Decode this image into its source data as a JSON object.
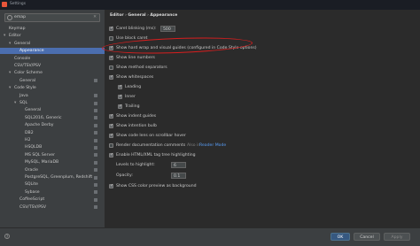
{
  "window": {
    "title": "Settings"
  },
  "search": {
    "value": "emap"
  },
  "tree": [
    {
      "label": "Keymap",
      "depth": 0,
      "arrow": "",
      "selected": false
    },
    {
      "label": "Editor",
      "depth": 0,
      "arrow": "open",
      "selected": false
    },
    {
      "label": "General",
      "depth": 1,
      "arrow": "open",
      "selected": false
    },
    {
      "label": "Appearance",
      "depth": 2,
      "arrow": "",
      "selected": true
    },
    {
      "label": "Console",
      "depth": 1,
      "arrow": "",
      "selected": false
    },
    {
      "label": "CSV/TSV/PSV",
      "depth": 1,
      "arrow": "",
      "selected": false
    },
    {
      "label": "Color Scheme",
      "depth": 1,
      "arrow": "open",
      "selected": false
    },
    {
      "label": "General",
      "depth": 2,
      "arrow": "",
      "selected": false
    },
    {
      "label": "Code Style",
      "depth": 1,
      "arrow": "open",
      "selected": false
    },
    {
      "label": "Java",
      "depth": 2,
      "arrow": "",
      "selected": false
    },
    {
      "label": "SQL",
      "depth": 2,
      "arrow": "open",
      "selected": false
    },
    {
      "label": "General",
      "depth": 3,
      "arrow": "",
      "selected": false
    },
    {
      "label": "SQL2016, Generic",
      "depth": 3,
      "arrow": "",
      "selected": false
    },
    {
      "label": "Apache Derby",
      "depth": 3,
      "arrow": "",
      "selected": false
    },
    {
      "label": "DB2",
      "depth": 3,
      "arrow": "",
      "selected": false
    },
    {
      "label": "H2",
      "depth": 3,
      "arrow": "",
      "selected": false
    },
    {
      "label": "HSQLDB",
      "depth": 3,
      "arrow": "",
      "selected": false
    },
    {
      "label": "MS SQL Server",
      "depth": 3,
      "arrow": "",
      "selected": false
    },
    {
      "label": "MySQL, MariaDB",
      "depth": 3,
      "arrow": "",
      "selected": false
    },
    {
      "label": "Oracle",
      "depth": 3,
      "arrow": "",
      "selected": false
    },
    {
      "label": "PostgreSQL, Greenplum, Redshift",
      "depth": 3,
      "arrow": "",
      "selected": false
    },
    {
      "label": "SQLite",
      "depth": 3,
      "arrow": "",
      "selected": false
    },
    {
      "label": "Sybase",
      "depth": 3,
      "arrow": "",
      "selected": false
    },
    {
      "label": "CoffeeScript",
      "depth": 2,
      "arrow": "",
      "selected": false
    },
    {
      "label": "CSV/TSV/PSV",
      "depth": 2,
      "arrow": "",
      "selected": false
    }
  ],
  "breadcrumb": {
    "part1": "Editor",
    "sep1": "›",
    "part2": "General",
    "sep2": "›",
    "part3": "Appearance"
  },
  "settings": {
    "caret_blinking_label": "Caret blinking (ms):",
    "caret_blinking_value": "500",
    "use_block_caret": "Use block caret",
    "show_hard_wrap": "Show hard wrap and visual guides (configured in Code Style options)",
    "show_line_numbers": "Show line numbers",
    "show_method_separators": "Show method separators",
    "show_whitespaces": "Show whitespaces",
    "leading": "Leading",
    "inner": "Inner",
    "trailing": "Trailing",
    "show_indent_guides": "Show indent guides",
    "show_intention_bulb": "Show intention bulb",
    "show_code_lens": "Show code lens on scrollbar hover",
    "render_docs": "Render documentation comments",
    "render_docs_hint": "Also in",
    "render_docs_link": "Reader Mode",
    "enable_html_xml": "Enable HTML/XML tag tree highlighting",
    "levels_label": "Levels to highlight:",
    "levels_value": "6",
    "opacity_label": "Opacity:",
    "opacity_value": "0.1",
    "show_css_preview": "Show CSS color preview as background"
  },
  "checked": {
    "use_block_caret": false,
    "show_hard_wrap": true,
    "show_line_numbers": true,
    "show_method_separators": false,
    "show_whitespaces": true,
    "leading": true,
    "inner": true,
    "trailing": true,
    "show_indent_guides": true,
    "show_intention_bulb": true,
    "show_code_lens": true,
    "render_docs": false,
    "enable_html_xml": true,
    "show_css_preview": true
  },
  "buttons": {
    "help": "?",
    "ok": "OK",
    "cancel": "Cancel",
    "apply": "Apply"
  },
  "colors": {
    "selection": "#4b6eaf",
    "annotation": "#d81e1e",
    "link": "#589df6"
  }
}
